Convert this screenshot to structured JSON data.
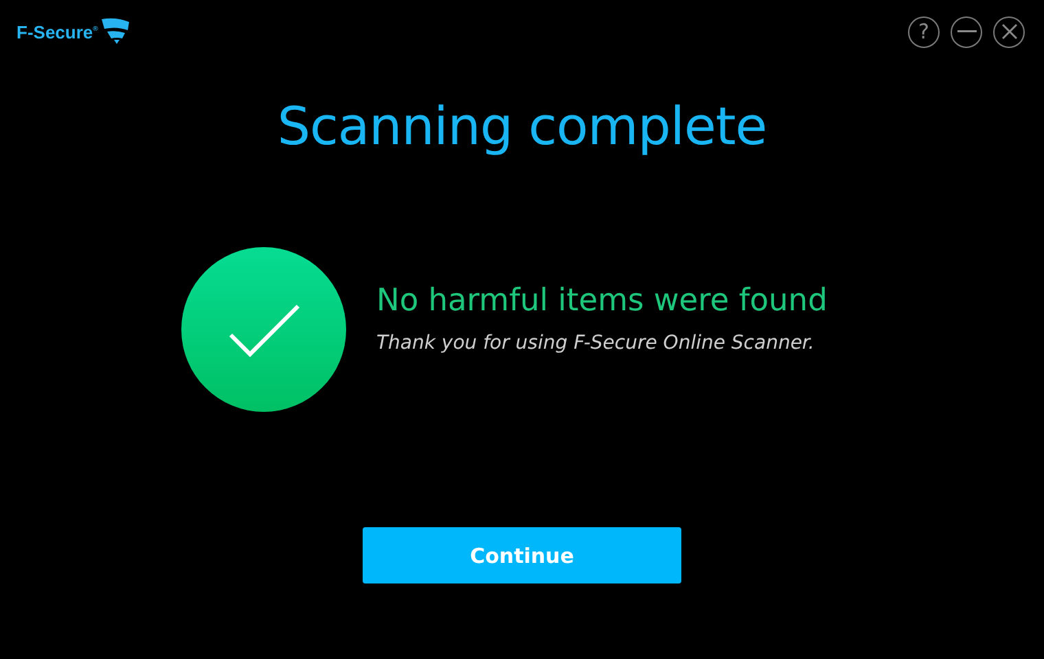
{
  "header": {
    "logo": "F-Secure$^{®}$",
    "controls": [
      {
        "kind": "help",
        "label": "?"
      },
      {
        "kind": "minimize"
      },
      {
        "kind": "close"
      }
    ]
  },
  "title": "Scanning complete",
  "result": {
    "clean": true,
    "heading": "No harmful items were found",
    "message": "Thank you for using F-Secure Online Scanner."
  },
  "button": "Continue"
}
